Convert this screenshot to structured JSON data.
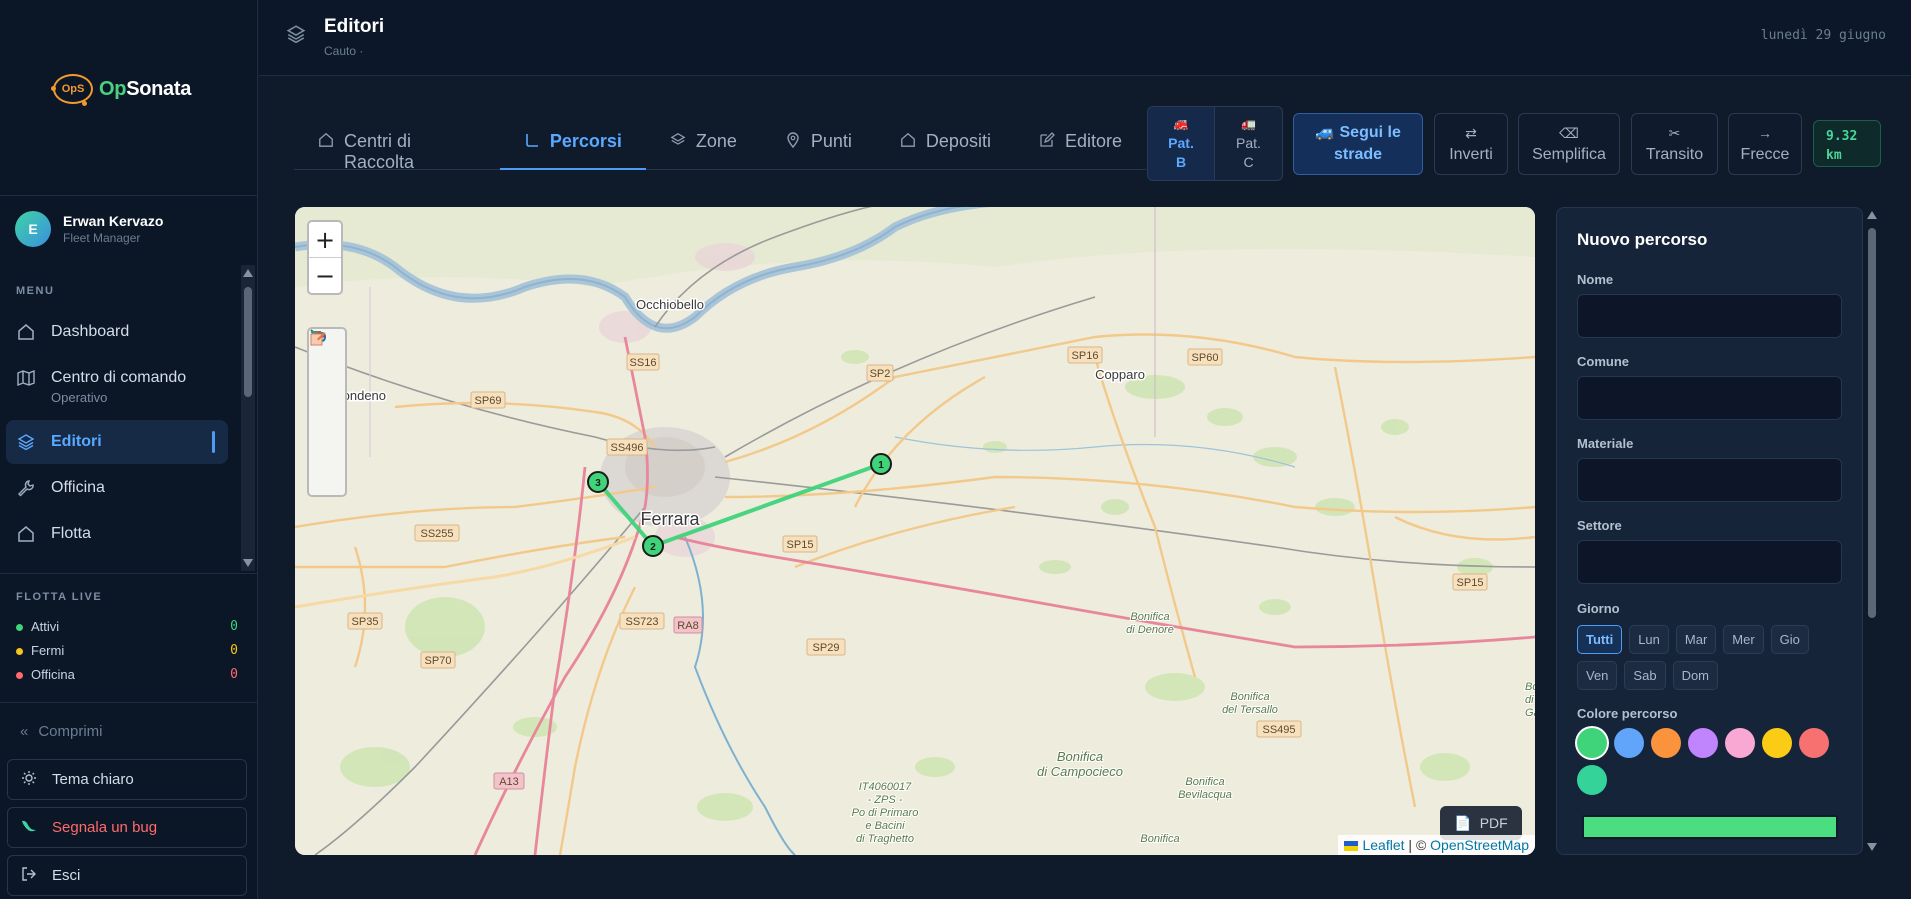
{
  "sidebar": {
    "logo_mark": "OpS",
    "logo_brand_a": "Op",
    "logo_brand_b": "Sonata",
    "user": {
      "initial": "E",
      "name": "Erwan Kervazo",
      "role": "Fleet Manager"
    },
    "menu_label": "MENU",
    "items": [
      {
        "label": "Dashboard",
        "icon": "home-icon"
      },
      {
        "label": "Centro di comando",
        "sub": "Operativo",
        "icon": "map-icon"
      },
      {
        "label": "Editori",
        "icon": "layers-icon",
        "active": true
      },
      {
        "label": "Officina",
        "icon": "wrench-icon"
      },
      {
        "label": "Flotta",
        "icon": "home-icon"
      }
    ],
    "fleet_label": "FLOTTA LIVE",
    "fleet": [
      {
        "label": "Attivi",
        "count": "0",
        "color": "#3fd37a"
      },
      {
        "label": "Fermi",
        "count": "0",
        "color": "#f5c518"
      },
      {
        "label": "Officina",
        "count": "0",
        "color": "#ff6b6b"
      }
    ],
    "compress": "Comprimi",
    "theme": "Tema chiaro",
    "bug": "Segnala un bug",
    "logout": "Esci"
  },
  "header": {
    "title": "Editori",
    "subtitle": "Cauto ·",
    "date": "lunedì 29 giugno"
  },
  "tabs": [
    {
      "label": "Centri di Raccolta",
      "icon": "home-icon"
    },
    {
      "label": "Percorsi",
      "icon": "route-icon",
      "active": true
    },
    {
      "label": "Zone",
      "icon": "layers-icon"
    },
    {
      "label": "Punti",
      "icon": "pin-icon"
    },
    {
      "label": "Depositi",
      "icon": "home-icon"
    },
    {
      "label": "Editore",
      "icon": "edit-icon"
    }
  ],
  "patents": [
    {
      "line1": "Pat.",
      "line2": "B",
      "icon": "truck-icon",
      "active": true
    },
    {
      "line1": "Pat.",
      "line2": "C",
      "icon": "truck-icon"
    }
  ],
  "toolbar": {
    "follow_roads_1": "Segui le",
    "follow_roads_2": "strade",
    "invert": "Inverti",
    "simplify": "Semplifica",
    "transit": "Transito",
    "arrows": "Frecce",
    "km_value": "9.32",
    "km_unit": "km"
  },
  "map": {
    "labels": {
      "ferrara": "Ferrara",
      "occhiobello": "Occhiobello",
      "bondeno": "Bondeno",
      "copparo": "Copparo",
      "bonifica_denore_1": "Bonifica",
      "bonifica_denore_2": "di Denore",
      "bonifica_tersallo_1": "Bonifica",
      "bonifica_tersallo_2": "del Tersallo",
      "bonifica_campo_1": "Bonifica",
      "bonifica_campo_2": "di Campocieco",
      "bonifica_bev_1": "Bonifica",
      "bonifica_bev_2": "Bevilacqua",
      "bonifica_mart": "Bonifica",
      "zps_1": "IT4060017",
      "zps_2": "- ZPS -",
      "zps_3": "Po di Primaro",
      "zps_4": "e Bacini",
      "zps_5": "di Traghetto",
      "edge_1": "Bon",
      "edge_2": "di V",
      "edge_3": "Gal"
    },
    "road_shields": [
      "SS16",
      "SP2",
      "SP16",
      "SP60",
      "SP69",
      "SS496",
      "SS255",
      "SP15",
      "SP15",
      "SS723",
      "RA8",
      "SP29",
      "SP35",
      "SP70",
      "SS495",
      "A13"
    ],
    "route_points": [
      "1",
      "2",
      "3"
    ],
    "route_color": "#3fd37a",
    "pdf": "PDF",
    "attribution_leaflet": "Leaflet",
    "attribution_sep": " | © ",
    "attribution_osm": "OpenStreetMap"
  },
  "panel": {
    "title": "Nuovo percorso",
    "fields": [
      {
        "label": "Nome",
        "value": ""
      },
      {
        "label": "Comune",
        "value": ""
      },
      {
        "label": "Materiale",
        "value": ""
      },
      {
        "label": "Settore",
        "value": ""
      }
    ],
    "day_label": "Giorno",
    "days": [
      "Tutti",
      "Lun",
      "Mar",
      "Mer",
      "Gio",
      "Ven",
      "Sab",
      "Dom"
    ],
    "color_label": "Colore percorso",
    "colors": [
      "#3fd37a",
      "#60a5fa",
      "#fb923c",
      "#c084fc",
      "#f9a8d4",
      "#facc15",
      "#f87171",
      "#34d399"
    ],
    "selected_color": "#4ade80"
  }
}
